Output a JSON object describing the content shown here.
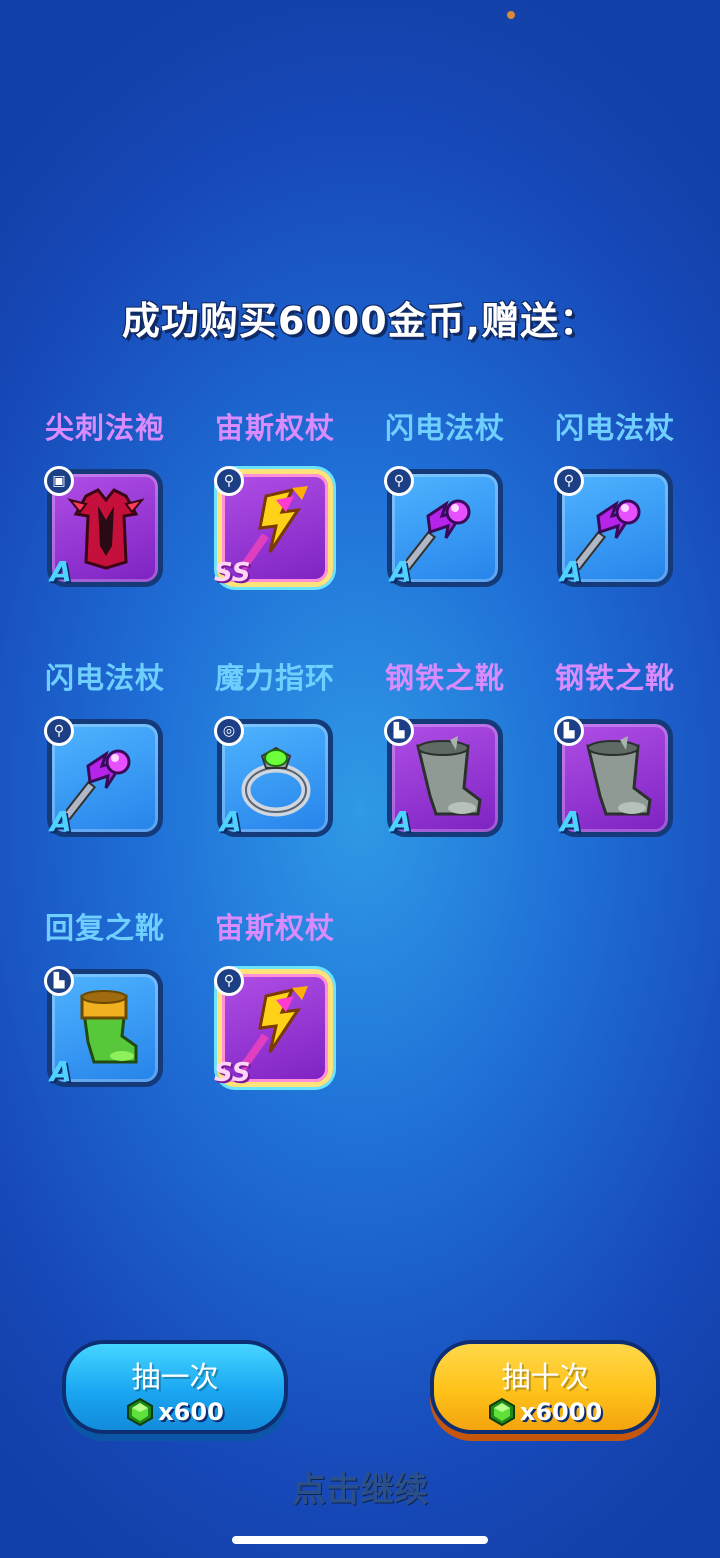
{
  "title": "成功购买6000金币,赠送：",
  "items": [
    {
      "name": "尖刺法袍",
      "name_color": "purple",
      "card": "purple",
      "grade": "A",
      "icon": "robe-icon",
      "slot_icon": "armor-slot-icon"
    },
    {
      "name": "宙斯权杖",
      "name_color": "purple",
      "card": "ss",
      "grade": "SS",
      "icon": "zeus-scepter-icon",
      "slot_icon": "weapon-slot-icon"
    },
    {
      "name": "闪电法杖",
      "name_color": "cyan",
      "card": "blue",
      "grade": "A",
      "icon": "lightning-staff-icon",
      "slot_icon": "weapon-slot-icon"
    },
    {
      "name": "闪电法杖",
      "name_color": "cyan",
      "card": "blue",
      "grade": "A",
      "icon": "lightning-staff-icon",
      "slot_icon": "weapon-slot-icon"
    },
    {
      "name": "闪电法杖",
      "name_color": "cyan",
      "card": "blue",
      "grade": "A",
      "icon": "lightning-staff-icon",
      "slot_icon": "weapon-slot-icon"
    },
    {
      "name": "魔力指环",
      "name_color": "cyan",
      "card": "blue",
      "grade": "A",
      "icon": "magic-ring-icon",
      "slot_icon": "ring-slot-icon"
    },
    {
      "name": "钢铁之靴",
      "name_color": "purple",
      "card": "purple",
      "grade": "A",
      "icon": "steel-boots-icon",
      "slot_icon": "boots-slot-icon"
    },
    {
      "name": "钢铁之靴",
      "name_color": "purple",
      "card": "purple",
      "grade": "A",
      "icon": "steel-boots-icon",
      "slot_icon": "boots-slot-icon"
    },
    {
      "name": "回复之靴",
      "name_color": "cyan",
      "card": "blue",
      "grade": "A",
      "icon": "recovery-boots-icon",
      "slot_icon": "boots-slot-icon"
    },
    {
      "name": "宙斯权杖",
      "name_color": "purple",
      "card": "ss",
      "grade": "SS",
      "icon": "zeus-scepter-icon",
      "slot_icon": "weapon-slot-icon"
    }
  ],
  "buttons": {
    "draw_one": {
      "label": "抽一次",
      "cost": "x600"
    },
    "draw_ten": {
      "label": "抽十次",
      "cost": "x6000"
    }
  },
  "continue_text": "点击继续",
  "colors": {
    "purple_name": "#d98bff",
    "cyan_name": "#6fcfff",
    "blue_button": "#1aa6f2",
    "gold_button": "#ffc21a"
  }
}
